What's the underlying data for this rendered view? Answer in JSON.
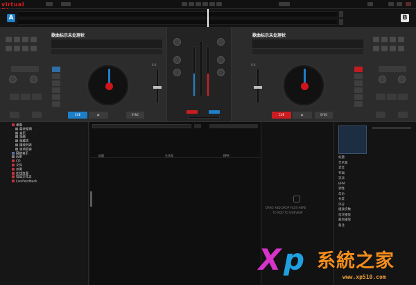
{
  "app": {
    "logo_text": "virtual DJ"
  },
  "decks": {
    "left": {
      "badge": "A",
      "track_title": "歌曲标示未处理状",
      "cue_label": "CUE",
      "play_label": "▶",
      "sync_label": "SYNC",
      "pitch_label": "0.0"
    },
    "right": {
      "badge": "B",
      "track_title": "歌曲标示未处理状",
      "cue_label": "CUE",
      "play_label": "▶",
      "sync_label": "SYNC",
      "pitch_label": "0.0"
    }
  },
  "browser": {
    "tree": [
      {
        "label": "桌面",
        "icon": "red"
      },
      {
        "label": "最近使用",
        "icon": "grey"
      },
      {
        "label": "音乐",
        "icon": "grey"
      },
      {
        "label": "视频",
        "icon": "grey"
      },
      {
        "label": "收藏夹",
        "icon": "grey"
      },
      {
        "label": "播放列表",
        "icon": "grey"
      },
      {
        "label": "自动混音",
        "icon": "grey"
      },
      {
        "label": "网络音乐",
        "icon": "blue"
      },
      {
        "label": "历史",
        "icon": "grey"
      },
      {
        "label": "CD",
        "icon": "red"
      },
      {
        "label": "文件",
        "icon": "red"
      },
      {
        "label": "示例",
        "icon": "red"
      },
      {
        "label": "在线资源",
        "icon": "red"
      },
      {
        "label": "智能文件夹",
        "icon": "red"
      },
      {
        "label": "LiveFeedback",
        "icon": "red"
      }
    ],
    "list_headers": {
      "title": "标题",
      "artist": "艺术家",
      "bpm": "BPM"
    },
    "sideview_hint_line1": "DRAG AND DROP FILES HERE",
    "sideview_hint_line2": "TO ADD TO SIDEVIEW",
    "info_rows": [
      "标题",
      "艺术家",
      "混音",
      "专辑",
      "流派",
      "BPM",
      "调性",
      "年份",
      "长度",
      "评分",
      "播放次数",
      "首次播放",
      "最后播放",
      "备注"
    ]
  },
  "watermark": {
    "brand_x": "X",
    "brand_p": "p",
    "brand_cn": "系統之家",
    "url": "www.xp510.com"
  }
}
